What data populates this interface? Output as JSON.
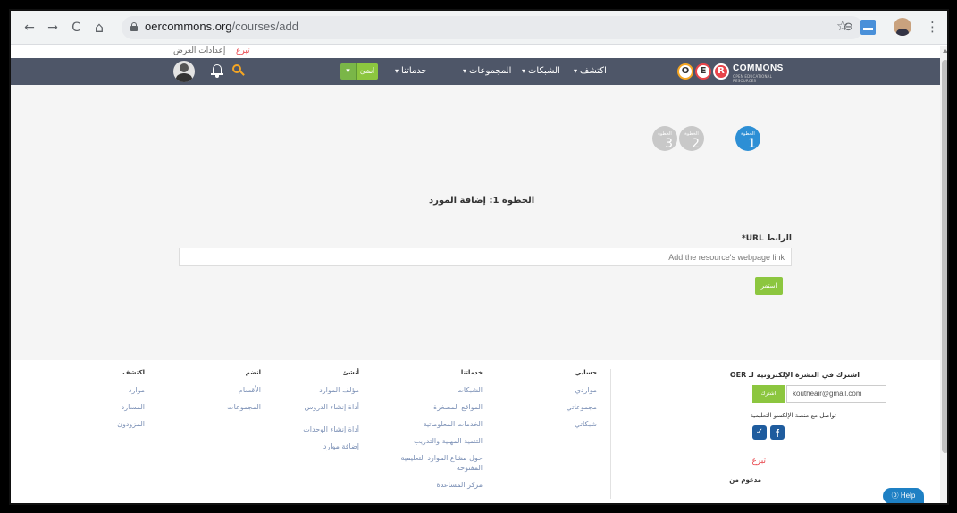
{
  "browser": {
    "url_domain": "oercommons.org",
    "url_path": "/courses/add",
    "back": "←",
    "forward": "→",
    "reload": "C",
    "home": "⌂",
    "menu": "⋮",
    "star": "☆",
    "zoom": "⊖"
  },
  "util_bar": {
    "display_settings": "إعدادات العرض",
    "donate": "تبرع"
  },
  "nav": {
    "share_label": "أنشئ",
    "caret": "▾",
    "items": [
      "خدماتنا",
      "المجموعات",
      "الشبكات",
      "اكتشف"
    ],
    "logo_letters": [
      "O",
      "E",
      "R"
    ],
    "logo_word": "COMMONS",
    "logo_sub": "OPEN EDUCATIONAL RESOURCES"
  },
  "steps": {
    "step_word": "الخطوة",
    "numbers": [
      "1",
      "2",
      "3"
    ]
  },
  "form": {
    "step_title": "الخطوة 1:  إضافة المورد",
    "url_label": "الرابط URL*",
    "url_placeholder": "Add the resource's webpage link",
    "next_label": "استمر"
  },
  "footer": {
    "columns": [
      {
        "head": "حسابي",
        "links": [
          "مواردي",
          "مجموعاتي",
          "شبكاتي"
        ]
      },
      {
        "head": "خدماتنا",
        "links": [
          "الشبكات",
          "المواقع المصغرة",
          "الخدمات المعلوماتية",
          "التنمية المهنية والتدريب",
          "حول مشاع الموارد التعليمية المفتوحة",
          "مركز المساعدة"
        ]
      },
      {
        "head": "أنشئ",
        "links": [
          "مؤلف الموارد",
          "أداة إنشاء الدروس",
          "أداة إنشاء الوحدات",
          "إضافة موارد"
        ]
      },
      {
        "head": "انضم",
        "links": [
          "الأقسام",
          "المجموعات"
        ]
      },
      {
        "head": "اكتشف",
        "links": [
          "موارد",
          "المسارد",
          "المزودون"
        ]
      }
    ],
    "subscribe_heading": "اشترك في النشرة الإلكترونية لـ OER",
    "email_value": "koutheair@gmail.com",
    "join_label": "اشترك",
    "connect_text": "تواصل مع منصة الإلكسو التعليمية",
    "donate": "تبرع",
    "supported_by": "مدعوم من",
    "help": "⓪ Help"
  }
}
